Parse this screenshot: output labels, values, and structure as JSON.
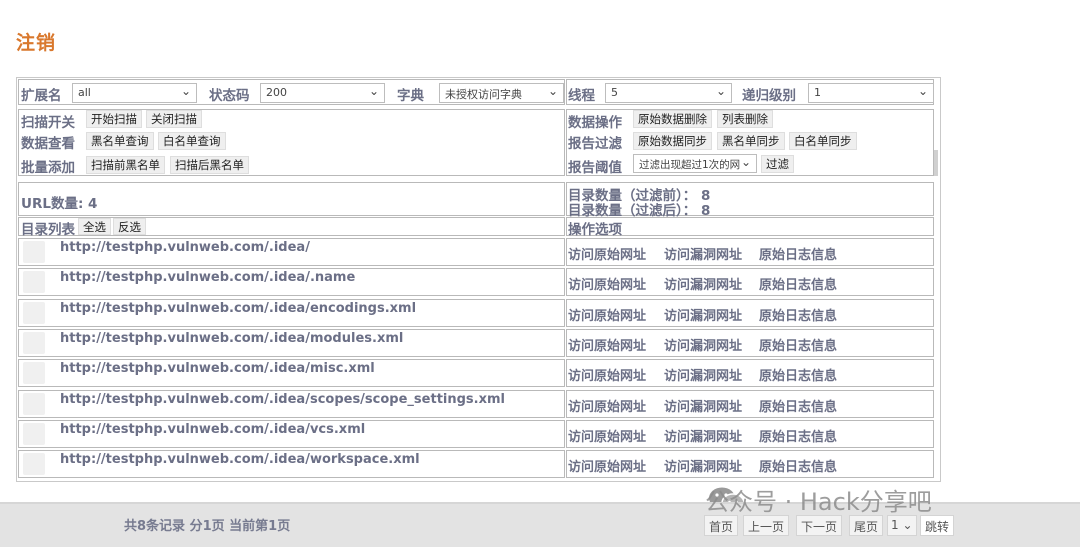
{
  "page": {
    "title": "注销"
  },
  "filters": {
    "ext_label": "扩展名",
    "ext_value": "all",
    "status_label": "状态码",
    "status_value": "200",
    "dict_label": "字典",
    "dict_value": "未授权访问字典",
    "thread_label": "线程",
    "thread_value": "5",
    "recursion_label": "递归级别",
    "recursion_value": "1"
  },
  "controls": {
    "scan_switch_label": "扫描开关",
    "start_scan": "开始扫描",
    "stop_scan": "关闭扫描",
    "data_op_label": "数据操作",
    "raw_delete": "原始数据删除",
    "list_delete": "列表删除",
    "data_view_label": "数据查看",
    "blacklist_query": "黑名单查询",
    "whitelist_query": "白名单查询",
    "report_filter_label": "报告过滤",
    "raw_sync": "原始数据同步",
    "blacklist_sync": "黑名单同步",
    "whitelist_sync": "白名单同步",
    "batch_add_label": "批量添加",
    "pre_scan_blacklist": "扫描前黑名单",
    "post_scan_blacklist": "扫描后黑名单",
    "report_threshold_label": "报告阈值",
    "threshold_value": "过滤出现超过1次的网",
    "filter_button": "过滤"
  },
  "stats": {
    "url_count": "URL数量: 4",
    "dir_before": "目录数量（过滤前）：  8",
    "dir_after": "目录数量（过滤后）：  8"
  },
  "list": {
    "title": "目录列表",
    "select_all": "全选",
    "invert": "反选",
    "ops_title": "操作选项",
    "op_original": "访问原始网址",
    "op_vuln": "访问漏洞网址",
    "op_log": "原始日志信息",
    "urls": [
      "http://testphp.vulnweb.com/.idea/",
      "http://testphp.vulnweb.com/.idea/.name",
      "http://testphp.vulnweb.com/.idea/encodings.xml",
      "http://testphp.vulnweb.com/.idea/modules.xml",
      "http://testphp.vulnweb.com/.idea/misc.xml",
      "http://testphp.vulnweb.com/.idea/scopes/scope_settings.xml",
      "http://testphp.vulnweb.com/.idea/vcs.xml",
      "http://testphp.vulnweb.com/.idea/workspace.xml"
    ]
  },
  "pagination": {
    "summary": "共8条记录 分1页 当前第1页",
    "first": "首页",
    "prev": "上一页",
    "next": "下一页",
    "last": "尾页",
    "page_value": "1",
    "jump": "跳转"
  },
  "watermark": "公众号 · Hack分享吧"
}
